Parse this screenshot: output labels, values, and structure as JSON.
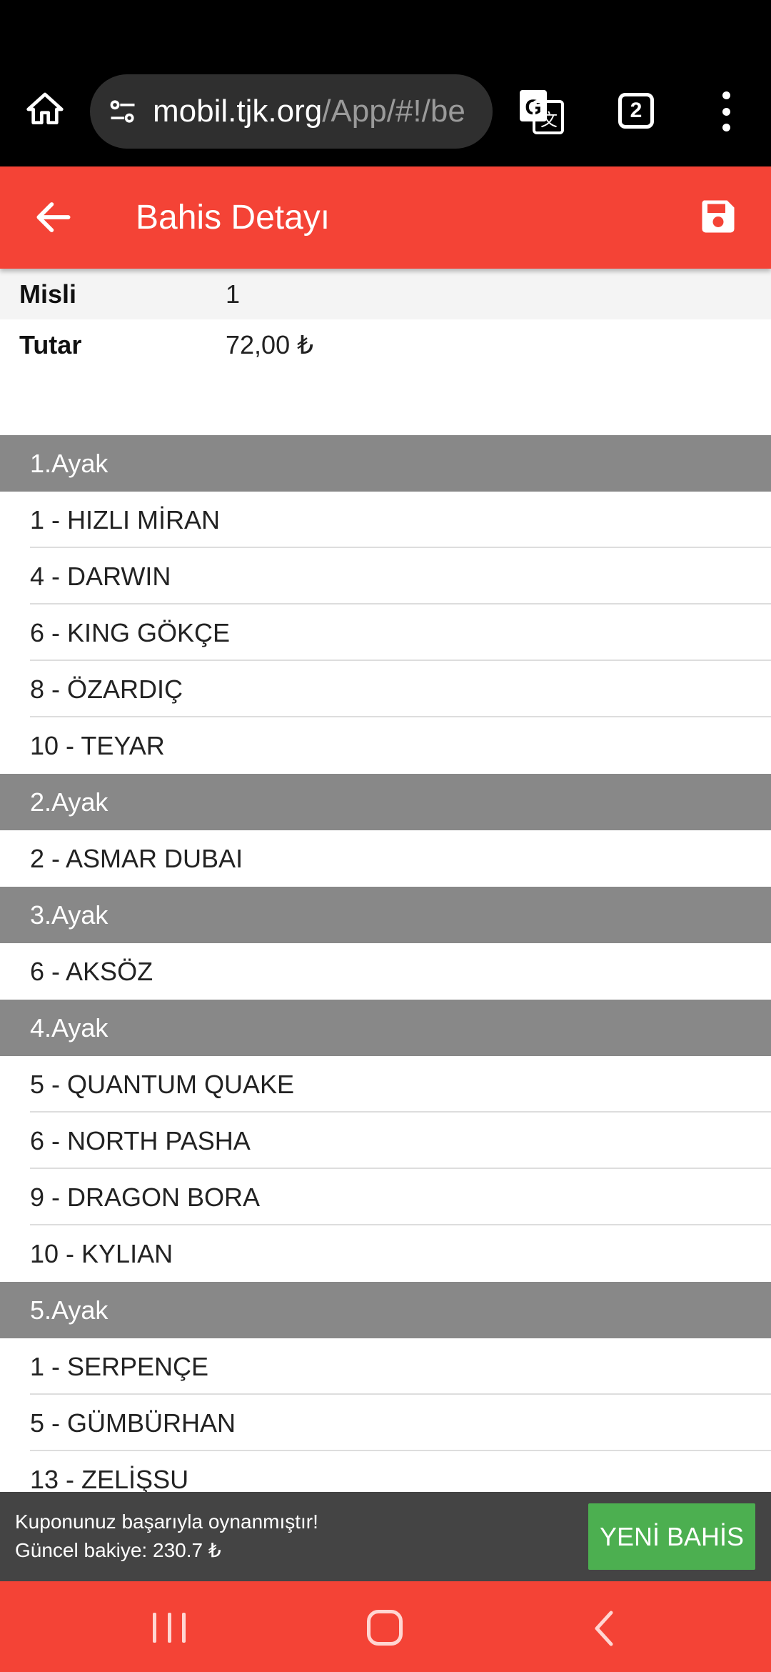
{
  "browser": {
    "url_host": "mobil.tjk.org",
    "url_path": "/App/#!/be",
    "tab_count": "2",
    "icons": [
      "home-icon",
      "site-settings-icon",
      "translate-icon",
      "tabs-icon",
      "more-vert-icon"
    ]
  },
  "header": {
    "title": "Bahis Detayı",
    "icons": [
      "back-arrow-icon",
      "save-icon"
    ],
    "color": "#f44336"
  },
  "summary": {
    "rows": [
      {
        "label": "Misli",
        "value": "1"
      },
      {
        "label": "Tutar",
        "value": "72,00 ₺"
      }
    ]
  },
  "legs": [
    {
      "title": "1.Ayak",
      "horses": [
        "1 - HIZLI MİRAN",
        "4 - DARWIN",
        "6 - KING GÖKÇE",
        "8 - ÖZARDIÇ",
        "10 - TEYAR"
      ]
    },
    {
      "title": "2.Ayak",
      "horses": [
        "2 - ASMAR DUBAI"
      ]
    },
    {
      "title": "3.Ayak",
      "horses": [
        "6 - AKSÖZ"
      ]
    },
    {
      "title": "4.Ayak",
      "horses": [
        "5 - QUANTUM QUAKE",
        "6 - NORTH PASHA",
        "9 - DRAGON BORA",
        "10 - KYLIAN"
      ]
    },
    {
      "title": "5.Ayak",
      "horses": [
        "1 - SERPENÇE",
        "5 - GÜMBÜRHAN",
        "13 - ZELİŞSU"
      ]
    }
  ],
  "toast": {
    "line1": "Kuponunuz başarıyla oynanmıştır!",
    "line2": "Güncel bakiye: 230.7 ₺",
    "button": "YENİ BAHİS",
    "button_color": "#4caf50"
  },
  "nav": {
    "icons": [
      "recent-apps-icon",
      "home-circle-icon",
      "back-chevron-icon"
    ]
  }
}
